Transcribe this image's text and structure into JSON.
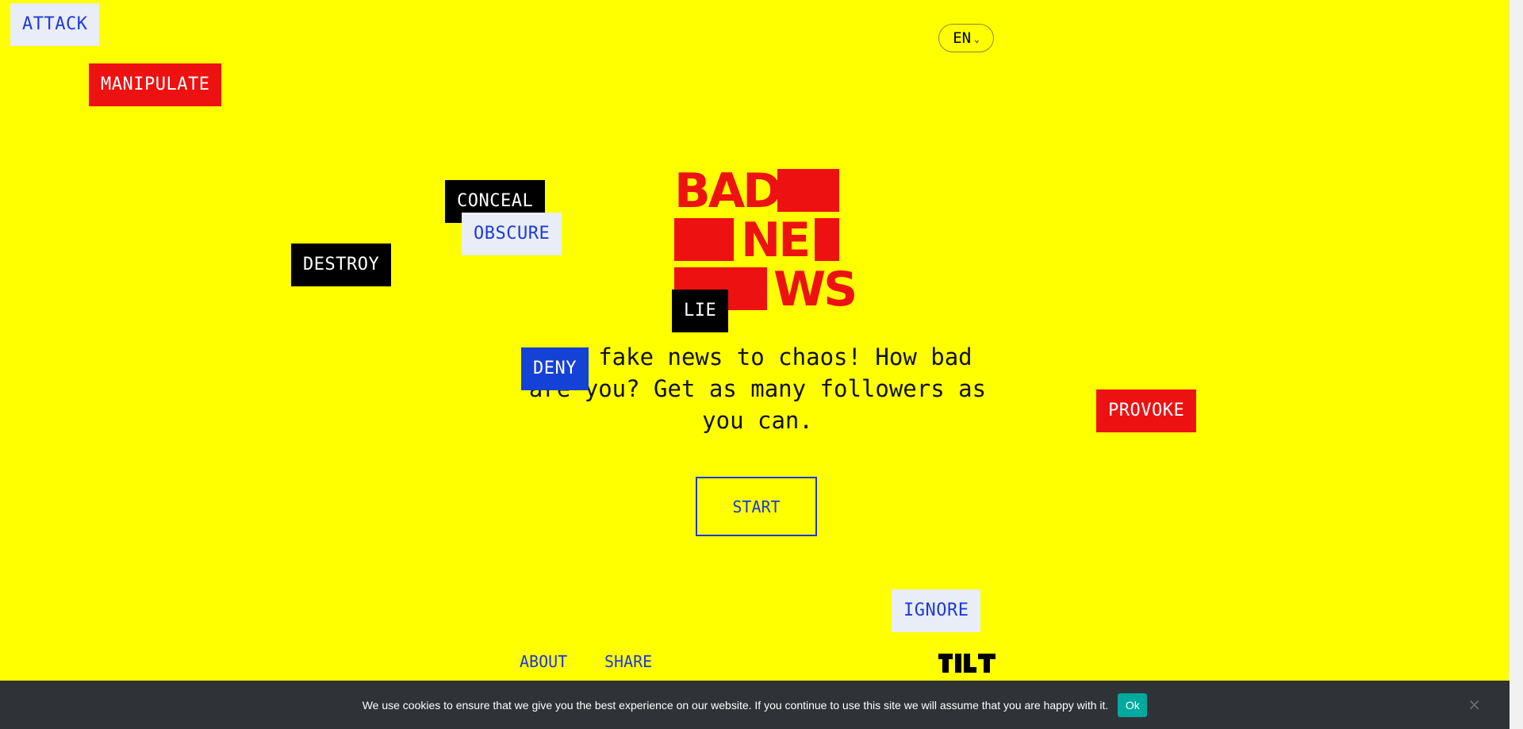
{
  "tags": {
    "attack": "ATTACK",
    "manipulate": "MANIPULATE",
    "conceal": "CONCEAL",
    "obscure": "OBSCURE",
    "destroy": "DESTROY",
    "lie": "LIE",
    "deny": "DENY",
    "provoke": "PROVOKE",
    "ignore": "IGNORE"
  },
  "language": {
    "label": "EN",
    "icon": "chevron-down-icon"
  },
  "logo": {
    "line1": "BAD",
    "line2": "NE",
    "line3": "WS",
    "color": "#ee1111"
  },
  "intro": {
    "text": "Use fake news to chaos! How bad are you? Get as many followers as you can."
  },
  "start_button": "START",
  "footer": {
    "about": "ABOUT",
    "share": "SHARE",
    "brand": "TILT"
  },
  "cookie": {
    "message": "We use cookies to ensure that we give you the best experience on our website. If you continue to use this site we will assume that you are happy with it.",
    "ok": "Ok",
    "close": "×"
  },
  "colors": {
    "background": "#ffff00",
    "red": "#ee1111",
    "blue": "#1f3ad6",
    "cookie_bar": "#2f3237",
    "ok_button": "#00a99d"
  }
}
